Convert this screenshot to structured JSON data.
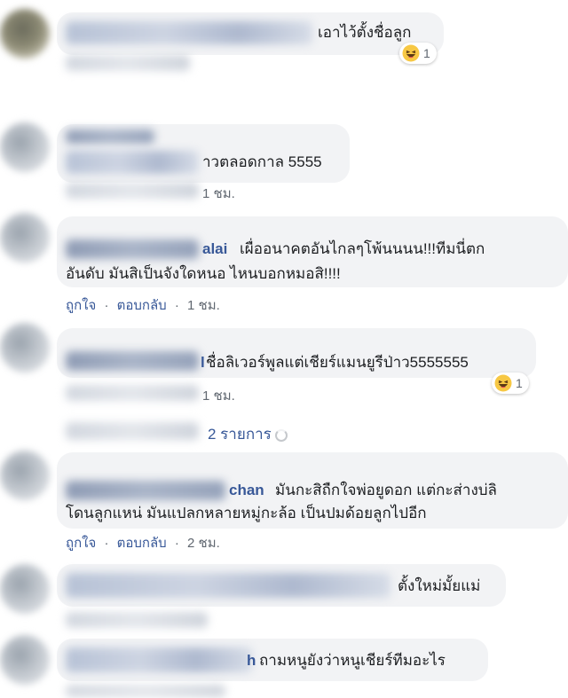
{
  "comments": [
    {
      "text": "เอาไว้ตั้งชื่อลูก",
      "reaction": {
        "icon": "haha-emoji-icon",
        "count": "1"
      }
    },
    {
      "text": "าวตลอดกาล 5555",
      "time": "1 ชม."
    },
    {
      "name_partial": "alai",
      "line1": "เผื่ออนาคตอันไกลๆโพ้นนนน!!!ทีมนี่ตก",
      "line2": "อันดับ มันสิเป็นจังใดหนอ ไหนบอกหมอสิ!!!!",
      "like": "ถูกใจ",
      "reply": "ตอบกลับ",
      "time": "1 ชม."
    },
    {
      "name_partial": "l",
      "text": "ชื่อลิเวอร์พูลแต่เชียร์แมนยูรีป่าว5555555",
      "time": "1 ชม.",
      "reaction": {
        "icon": "haha-emoji-icon",
        "count": "1"
      },
      "replies_label": "2 รายการ"
    },
    {
      "name_partial": "chan",
      "line1": "มันกะสิถืกใจพ่อยูดอก แต่กะส่างบ่ลิ",
      "line2": "โดนลูกแหน่ มันแปลกหลายหมู่กะล้อ เป็นปมด้อยลูกไปอีก",
      "like": "ถูกใจ",
      "reply": "ตอบกลับ",
      "time": "2 ชม."
    },
    {
      "text": "ตั้งใหม่มั้ยแม่"
    },
    {
      "name_partial": "h",
      "text": "ถามหนูยังว่าหนูเชียร์ทีมอะไร"
    }
  ],
  "separator": "·",
  "colors": {
    "bubble": "#f2f3f5",
    "link": "#385898",
    "meta": "#606770",
    "text": "#1c1e21"
  }
}
